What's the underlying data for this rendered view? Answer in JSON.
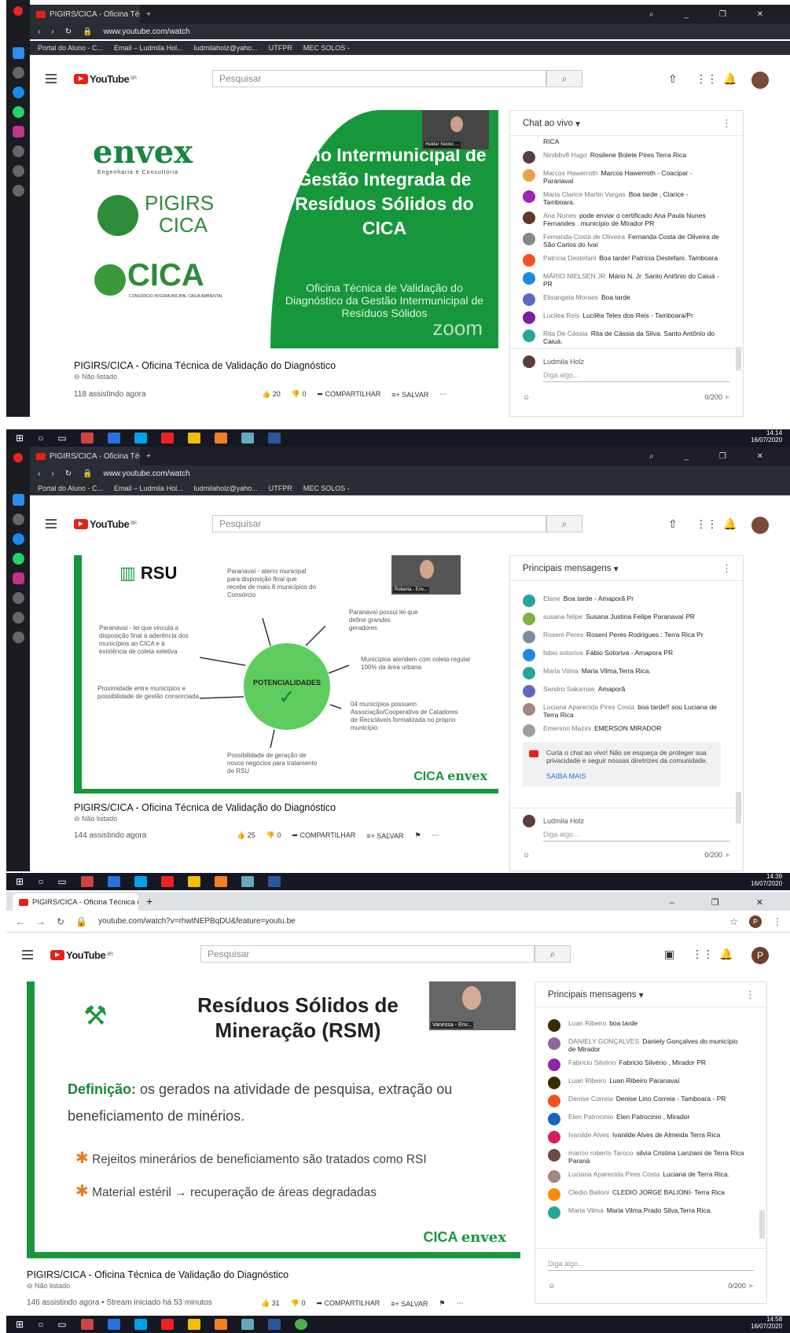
{
  "browser": {
    "tab_title_1": "PIGIRS/CICA - Oficina Técn",
    "tab_title_3": "PIGIRS/CICA - Oficina Técnica de",
    "url_short": "www.youtube.com/watch",
    "url_full": "youtube.com/watch?v=rhwtNEPBqDU&feature=youtu.be",
    "bookmarks": [
      "Portal do Aluno - C...",
      "Email – Ludmila Hol...",
      "ludmilaholz@yaho...",
      "UTFPR",
      "MEC SOLOS -"
    ]
  },
  "youtube": {
    "logo": "YouTube",
    "region": "BR",
    "search_placeholder": "Pesquisar",
    "avatar_letter": "P"
  },
  "video": {
    "title": "PIGIRS/CICA - Oficina Técnica de Validação do Diagnóstico",
    "unlisted": "Não listado",
    "share": "COMPARTILHAR",
    "save": "SALVAR"
  },
  "shot1": {
    "views": "118 assistindo agora",
    "likes": "20",
    "dislikes": "0",
    "webcam_name": "Helder Nocko ...",
    "slide": {
      "brand": "envex",
      "brand_sub": "Engenharia e Consultoria",
      "logo2_a": "PIGIRS",
      "logo2_b": "CICA",
      "logo3": "CICA",
      "logo3_sub": "CONSÓRCIO INTERMUNICIPAL CAIUÁ AMBIENTAL",
      "title": "Plano Intermunicipal de Gestão Integrada de Resíduos Sólidos do CICA",
      "subtitle": "Oficina Técnica de Validação do Diagnóstico da Gestão Intermunicipal de Resíduos Sólidos",
      "zoom": "zoom"
    },
    "chat_title": "Chat ao vivo",
    "chat": [
      {
        "author": "",
        "text": "RICA"
      },
      {
        "author": "Ninibbv8 Hago",
        "text": "Rosilene Bolete Pires Terra Rica"
      },
      {
        "author": "Marcos Hawerroth",
        "text": "Marcos Hawerroth - Coacipar - Paranavaí"
      },
      {
        "author": "Maria Clarice Martin Vargas",
        "text": "Boa tarde , Clarice - Tamboara."
      },
      {
        "author": "Ana Nunes",
        "text": "pode enviar o certificado Ana Paula Nunes Fernandes . município de Mirador PR"
      },
      {
        "author": "Fernanda Costa de Oliveira",
        "text": "Fernanda Costa de Oliveira de São Carlos do Ivaí"
      },
      {
        "author": "Patrícia Destefani",
        "text": "Boa tarde! Patrícia Destefani. Tamboara"
      },
      {
        "author": "MÁRIO NIELSEN JR",
        "text": "Mário N. Jr. Santo Antônio do Caiuá - PR"
      },
      {
        "author": "Elisangela Moraes",
        "text": "Boa tarde"
      },
      {
        "author": "Lucilea Reis",
        "text": "Lucilêa Teles dos Reis - Tamboara/Pr"
      },
      {
        "author": "Rita De Cássia",
        "text": "Rita de Cássia da Silva. Santo Antônio do Caiuá."
      }
    ],
    "user": "Ludmila Holz",
    "input_placeholder": "Diga algo...",
    "counter": "0/200",
    "time": "14:14",
    "date": "16/07/2020"
  },
  "shot2": {
    "views": "144 assistindo agora",
    "likes": "25",
    "dislikes": "0",
    "webcam_name": "Roberta - Env...",
    "slide": {
      "title": "RSU",
      "center": "POTENCIALIDADES",
      "items": [
        "Paranavaí - aterro municipal para disposição final que recebe de mais 8 municípios do Consórcio",
        "Paranavaí possui lei que define grandes geradores",
        "Paranavaí - lei que vincula a disposição final à aderência dos municípios ao CICA e à existência de coleta seletiva",
        "Municípios atendem com coleta regular 100% da área urbana",
        "Proximidade entre municípios e possibilidade de gestão consorciada",
        "04 municípios possuem Associação/Cooperativa de Catadores de Recicláveis formalizada no próprio município",
        "Possibilidade de geração de novos negócios para tratamento de RSU"
      ],
      "logo_a": "CICA",
      "logo_b": "envex"
    },
    "chat_title": "Principais mensagens",
    "chat": [
      {
        "author": "Elane",
        "text": "Boa tarde - Amaporã Pr"
      },
      {
        "author": "susana felipe",
        "text": "Susana Justina Felipe Paranavaí PR"
      },
      {
        "author": "Roseni Peres",
        "text": "Roseni Peres Rodrigues : Terra Rica Pr"
      },
      {
        "author": "fabio sotoriva",
        "text": "Fábio Sotoriva - Amapora PR"
      },
      {
        "author": "Maria Vilma",
        "text": "Maria Vilma,Terra Rica."
      },
      {
        "author": "Sandro Sakamae",
        "text": "Amaporã"
      },
      {
        "author": "Luciana Aparecida Pires Costa",
        "text": "boa tarde!! sou Luciana de Terra Rica"
      },
      {
        "author": "Emerson Mazini",
        "text": "EMERSON MIRADOR"
      }
    ],
    "notice": "Curta o chat ao vivo! Não se esqueça de proteger sua privacidade e seguir nossas diretrizes da comunidade.",
    "notice_link": "SAIBA MAIS",
    "user": "Ludmila Holz",
    "input_placeholder": "Diga algo...",
    "counter": "0/200",
    "time": "14:39",
    "date": "16/07/2020"
  },
  "shot3": {
    "views": "146 assistindo agora • Stream iniciado há 53 minutos",
    "likes": "31",
    "dislikes": "0",
    "webcam_name": "Vanessa - Env...",
    "slide": {
      "title": "Resíduos Sólidos de Mineração (RSM)",
      "definition_label": "Definição:",
      "definition_text": "os gerados na atividade de pesquisa, extração ou beneficiamento de minérios.",
      "bullet1": "Rejeitos minerários de beneficiamento são tratados como RSI",
      "bullet2": "Material estéril → recuperação de áreas degradadas",
      "logo_a": "CICA",
      "logo_b": "envex"
    },
    "chat_title": "Principais mensagens",
    "chat": [
      {
        "author": "Luan Ribeiro",
        "text": "boa tarde"
      },
      {
        "author": "DANIELY GONÇALVES",
        "text": "Daniely Gonçalves do município de Mirador"
      },
      {
        "author": "Fabricio Silvério",
        "text": "Fabricio Silvério , Mirador PR"
      },
      {
        "author": "Luan Ribeiro",
        "text": "Luan Ribeiro Paranavaí"
      },
      {
        "author": "Denise Correia",
        "text": "Denise Lino Correia - Tamboara - PR"
      },
      {
        "author": "Elen Patrocinio",
        "text": "Elen Patrocinio , Mirador"
      },
      {
        "author": "Ivanilde Alves",
        "text": "Ivanilde Alves de Almeida Terra Rica"
      },
      {
        "author": "marcio roberto Taroco",
        "text": "silvia Cristina Lanziani de Terra Rica Paraná"
      },
      {
        "author": "Luciana Aparecida Pires Costa",
        "text": "Luciana de Terra Rica."
      },
      {
        "author": "Cledio Balioni",
        "text": "CLEDIO JORGE BALIONI- Terra Rica"
      },
      {
        "author": "Maria Vilma",
        "text": "Maria Vilma Prado Silva,Terra Rica."
      }
    ],
    "input_placeholder": "Diga algo...",
    "counter": "0/200",
    "time": "14:58",
    "date": "16/07/2020"
  },
  "colors": {
    "slide_green": "#17973b",
    "youtube_red": "#e62117",
    "taskbar": "#151823"
  }
}
